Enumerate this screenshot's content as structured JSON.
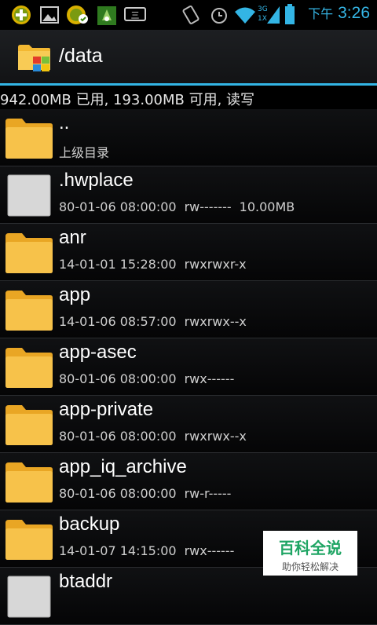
{
  "status_bar": {
    "time": "3:26",
    "ampm": "下午",
    "icons": [
      "add-icon",
      "gallery-icon",
      "download-icon",
      "usb-icon",
      "keyboard-icon",
      "vibrate-icon",
      "alarm-icon",
      "wifi-icon",
      "signal-icon",
      "battery-icon"
    ],
    "signal_labels": {
      "top": "3G",
      "bottom": "1X"
    },
    "keyboard_label": "三",
    "accent": "#35b5e5"
  },
  "action_bar": {
    "title": "/data",
    "icon": "folder-app-icon"
  },
  "storage": {
    "text": "942.00MB 已用, 193.00MB 可用, 读写"
  },
  "files": [
    {
      "name": "..",
      "meta": [
        "上级目录"
      ],
      "type": "folder"
    },
    {
      "name": ".hwplace",
      "meta": [
        "80-01-06 08:00:00",
        "rw-------",
        "10.00MB"
      ],
      "type": "file"
    },
    {
      "name": "anr",
      "meta": [
        "14-01-01 15:28:00",
        "rwxrwxr-x"
      ],
      "type": "folder"
    },
    {
      "name": "app",
      "meta": [
        "14-01-06 08:57:00",
        "rwxrwx--x"
      ],
      "type": "folder"
    },
    {
      "name": "app-asec",
      "meta": [
        "80-01-06 08:00:00",
        "rwx------"
      ],
      "type": "folder"
    },
    {
      "name": "app-private",
      "meta": [
        "80-01-06 08:00:00",
        "rwxrwx--x"
      ],
      "type": "folder"
    },
    {
      "name": "app_iq_archive",
      "meta": [
        "80-01-06 08:00:00",
        "rw-r-----"
      ],
      "type": "folder"
    },
    {
      "name": "backup",
      "meta": [
        "14-01-07 14:15:00",
        "rwx------"
      ],
      "type": "folder"
    },
    {
      "name": "btaddr",
      "meta": [],
      "type": "file"
    }
  ],
  "watermark": {
    "main": "百科全说",
    "sub": "助你轻松解决"
  }
}
